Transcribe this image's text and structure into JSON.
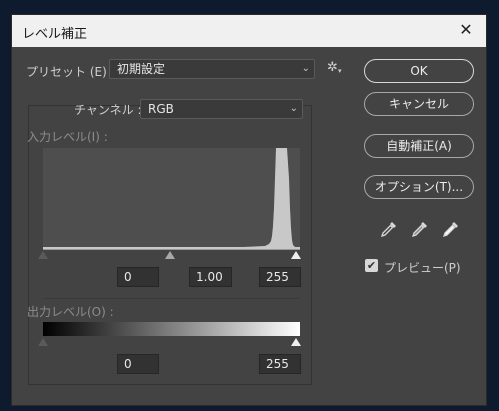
{
  "window": {
    "title": "レベル補正",
    "close_glyph": "✕"
  },
  "preset": {
    "label": "プリセット (E) :",
    "value": "初期設定",
    "gear_glyph": "✲"
  },
  "channel": {
    "label": "チャンネル :",
    "value": "RGB"
  },
  "input_levels": {
    "label": "入力レベル(I) :",
    "black": "0",
    "gamma": "1.00",
    "white": "255"
  },
  "output_levels": {
    "label": "出力レベル(O) :",
    "black": "0",
    "white": "255"
  },
  "buttons": {
    "ok": "OK",
    "cancel": "キャンセル",
    "auto": "自動補正(A)",
    "options": "オプション(T)..."
  },
  "preview": {
    "label": "プレビュー(P)",
    "checked": true
  }
}
